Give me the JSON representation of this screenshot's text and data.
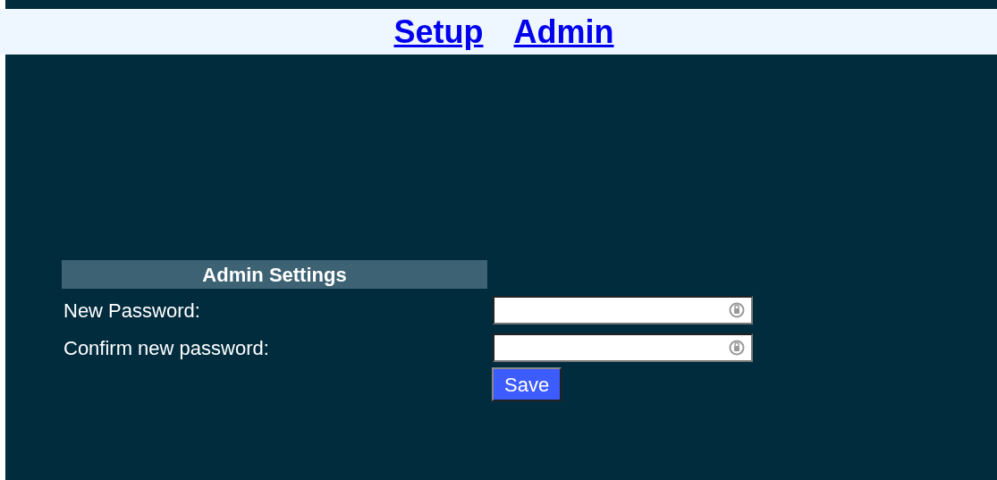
{
  "nav_links": [
    "Setup",
    "Admin"
  ],
  "admin_settings": {
    "title": "Admin Settings",
    "fields": [
      {
        "label": "New Password:"
      },
      {
        "label": "Confirm new password:"
      }
    ],
    "save_button": "Save"
  }
}
